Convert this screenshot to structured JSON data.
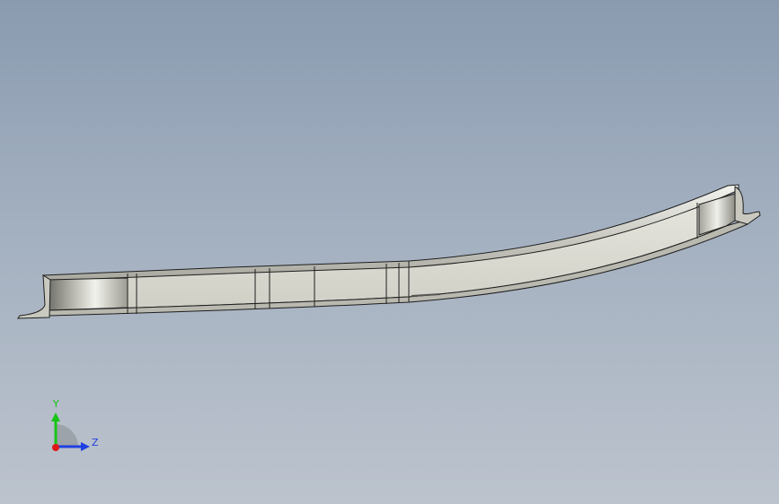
{
  "viewport": {
    "background_top": "#8a9bb0",
    "background_bottom": "#bcc3cd"
  },
  "part": {
    "face_color": "#d8d8d0",
    "edge_color": "#1e1e1e"
  },
  "triad": {
    "y_label": "Y",
    "z_label": "Z",
    "y_color": "#16c416",
    "z_color": "#1f3fe0",
    "x_color": "#e01818"
  }
}
